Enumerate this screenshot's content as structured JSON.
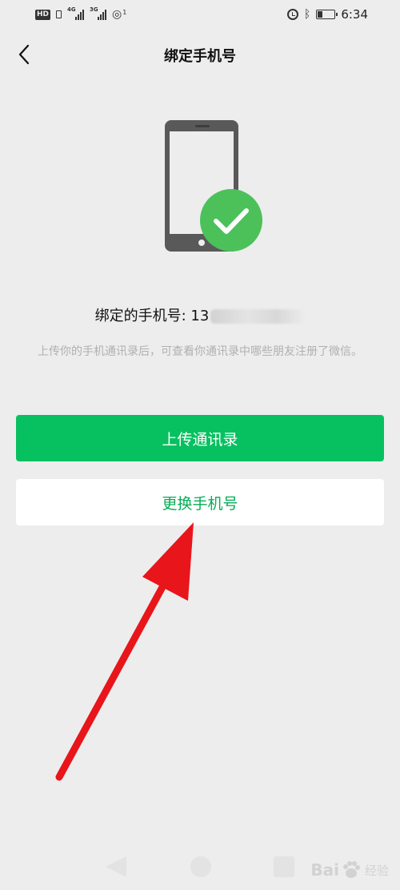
{
  "status_bar": {
    "hd": "HD",
    "net1": "4G",
    "net2": "3G",
    "hotspot_count": "1",
    "time": "6:34"
  },
  "nav": {
    "title": "绑定手机号",
    "back_icon": "chevron-left-icon"
  },
  "illustration": {
    "phone_icon": "smartphone-icon",
    "check_icon": "check-circle-icon",
    "phone_color": "#595959",
    "check_color": "#4cc15a"
  },
  "bound": {
    "label": "绑定的手机号: 13",
    "masked_note": ""
  },
  "description": "上传你的手机通讯录后，可查看你通讯录中哪些朋友注册了微信。",
  "buttons": {
    "upload_contacts": "上传通讯录",
    "change_phone": "更换手机号"
  },
  "colors": {
    "primary_green": "#07c160",
    "secondary_text_green": "#06ad56",
    "arrow_red": "#e8151b"
  },
  "annotation": {
    "arrow_icon": "red-arrow-icon"
  },
  "watermark": {
    "brand": "Bai",
    "brand_tail": "经验",
    "icon": "baidu-paw-icon"
  }
}
